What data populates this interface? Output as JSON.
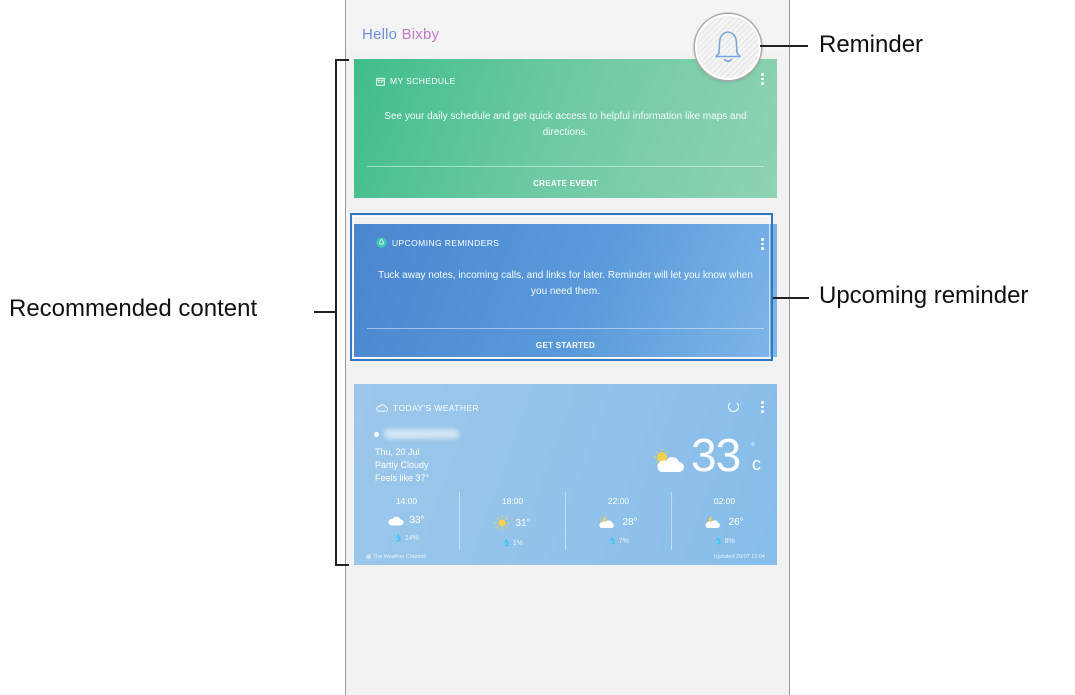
{
  "header": {
    "greeting_hello": "Hello",
    "greeting_name": "Bixby"
  },
  "cards": {
    "schedule": {
      "title": "MY SCHEDULE",
      "body": "See your daily schedule and get quick access to helpful information like maps and directions.",
      "action": "CREATE EVENT"
    },
    "reminders": {
      "title": "UPCOMING REMINDERS",
      "body": "Tuck away notes, incoming calls, and links for later. Reminder will let you know when you need them.",
      "action": "GET STARTED"
    },
    "weather": {
      "title": "TODAY'S WEATHER",
      "date": "Thu, 20 Jul",
      "condition": "Partly Cloudy",
      "feels_like": "Feels like 37°",
      "temperature": "33",
      "degree": "°",
      "unit": "c",
      "hours": [
        {
          "time": "14:00",
          "temp": "33°",
          "precip": "💧 14%",
          "icon": "cloud-icon"
        },
        {
          "time": "18:00",
          "temp": "31°",
          "precip": "💧 1%",
          "icon": "sun-icon"
        },
        {
          "time": "22:00",
          "temp": "28°",
          "precip": "💧 7%",
          "icon": "moon-cloud-icon"
        },
        {
          "time": "02:00",
          "temp": "26°",
          "precip": "💧 8%",
          "icon": "moon-cloud-icon"
        }
      ],
      "source": "The Weather Channel",
      "updated": "Updated 20/07 13:04"
    }
  },
  "callouts": {
    "reminder": "Reminder",
    "upcoming_reminder": "Upcoming reminder",
    "recommended_content": "Recommended content"
  },
  "colors": {
    "schedule_card": "#3fbd8a",
    "reminder_card": "#4a86d0",
    "weather_card": "#93c3ea",
    "highlight_border": "#2f78c5"
  }
}
